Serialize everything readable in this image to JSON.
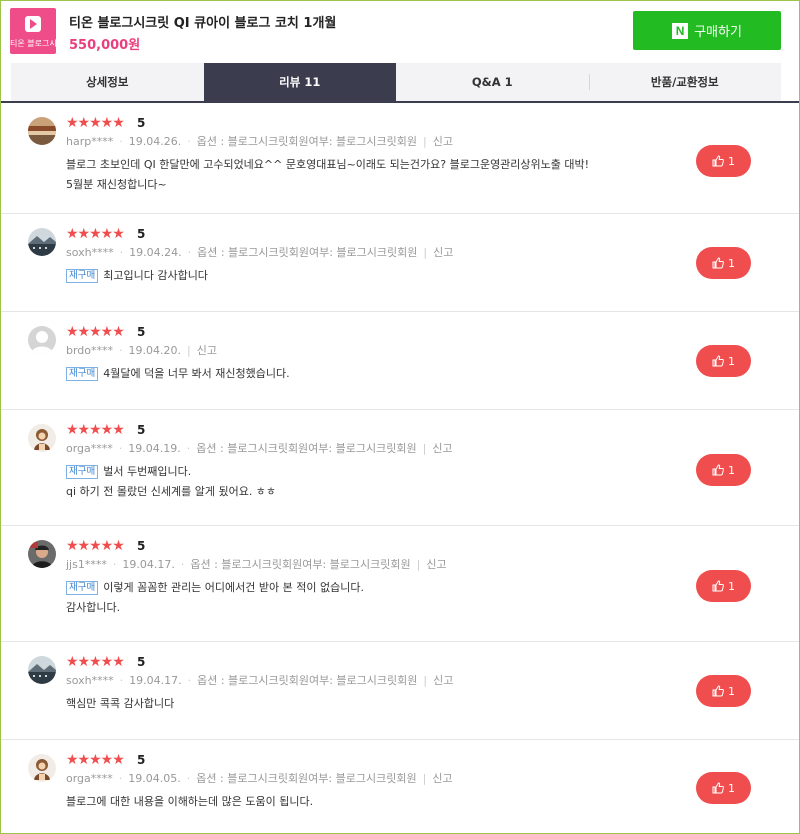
{
  "product": {
    "thumb_text": "티온 블로그시크릿",
    "title": "티온 블로그시크릿 QI 큐아이 블로그 코치 1개월",
    "price": "550,000원",
    "buy_icon": "N",
    "buy_label": "구매하기"
  },
  "tabs": [
    {
      "label": "상세정보"
    },
    {
      "label": "리뷰 11",
      "active": true
    },
    {
      "label": "Q&A 1"
    },
    {
      "label": "반품/교환정보"
    }
  ],
  "reviews": [
    {
      "stars": "★★★★★",
      "score": "5",
      "user": "harp****",
      "date": "19.04.26.",
      "option": "옵션 : 블로그시크릿회원여부: 블로그시크릿회원",
      "report": "신고",
      "rebuy": "",
      "lines": [
        "블로그 초보인데  QI 한달만에 고수되었네요^^ 문호영대표님~이래도 되는건가요? 블로그운영관리상위노출 대박!",
        "5월분 재신청합니다~"
      ],
      "likes": "1",
      "avatar": "landscape"
    },
    {
      "stars": "★★★★★",
      "score": "5",
      "user": "soxh****",
      "date": "19.04.24.",
      "option": "옵션 : 블로그시크릿회원여부: 블로그시크릿회원",
      "report": "신고",
      "rebuy": "재구매",
      "lines": [
        "최고입니다 감사합니다"
      ],
      "likes": "1",
      "avatar": "city"
    },
    {
      "stars": "★★★★★",
      "score": "5",
      "user": "brdo****",
      "date": "19.04.20.",
      "option": "",
      "report": "신고",
      "rebuy": "재구매",
      "lines": [
        "4월달에 덕을 너무 봐서 재신청했습니다."
      ],
      "likes": "1",
      "avatar": "default"
    },
    {
      "stars": "★★★★★",
      "score": "5",
      "user": "orga****",
      "date": "19.04.19.",
      "option": "옵션 : 블로그시크릿회원여부: 블로그시크릿회원",
      "report": "신고",
      "rebuy": "재구매",
      "lines": [
        "벌서 두번째입니다.",
        "qi 하기 전 몰랐던 신세계를 알게 됬어요. ㅎㅎ"
      ],
      "likes": "1",
      "avatar": "character"
    },
    {
      "stars": "★★★★★",
      "score": "5",
      "user": "jjs1****",
      "date": "19.04.17.",
      "option": "옵션 : 블로그시크릿회원여부: 블로그시크릿회원",
      "report": "신고",
      "rebuy": "재구매",
      "lines": [
        "이렇게 꼼꼼한 관리는 어디에서건 받아 본 적이 없습니다.",
        "감사합니다."
      ],
      "likes": "1",
      "avatar": "person"
    },
    {
      "stars": "★★★★★",
      "score": "5",
      "user": "soxh****",
      "date": "19.04.17.",
      "option": "옵션 : 블로그시크릿회원여부: 블로그시크릿회원",
      "report": "신고",
      "rebuy": "",
      "lines": [
        "핵심만 콕콕 감사합니다"
      ],
      "likes": "1",
      "avatar": "city"
    },
    {
      "stars": "★★★★★",
      "score": "5",
      "user": "orga****",
      "date": "19.04.05.",
      "option": "옵션 : 블로그시크릿회원여부: 블로그시크릿회원",
      "report": "신고",
      "rebuy": "",
      "lines": [
        "블로그에 대한 내용을 이해하는데 많은 도움이 됩니다."
      ],
      "likes": "1",
      "avatar": "character"
    }
  ],
  "icons": {
    "like": "thumbs-up-icon",
    "star": "star-icon",
    "play": "play-icon"
  },
  "colors": {
    "brand": "#ee4d8a",
    "price": "#e8407e",
    "buy": "#22bb22",
    "active_tab": "#3b3d4e",
    "like": "#f04e4e",
    "stars": "#f04e4e",
    "rebuy": "#3f86d4"
  }
}
